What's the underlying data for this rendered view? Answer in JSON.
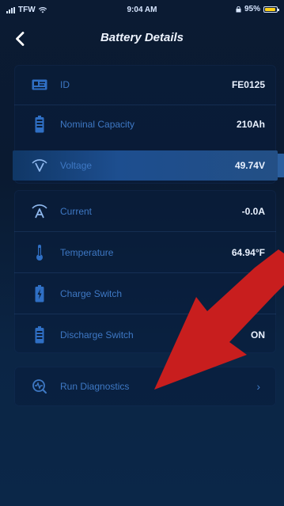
{
  "status_bar": {
    "carrier": "TFW",
    "time": "9:04 AM",
    "battery_percent": "95%"
  },
  "header": {
    "title": "Battery Details"
  },
  "details": [
    {
      "label": "ID",
      "value": "FE0125"
    },
    {
      "label": "Nominal Capacity",
      "value": "210Ah"
    },
    {
      "label": "Voltage",
      "value": "49.74V"
    },
    {
      "label": "Current",
      "value": "-0.0A"
    },
    {
      "label": "Temperature",
      "value": "64.94°F"
    },
    {
      "label": "Charge Switch",
      "value": ""
    },
    {
      "label": "Discharge Switch",
      "value": "ON"
    }
  ],
  "actions": {
    "run_diagnostics": "Run Diagnostics",
    "chevron": "›"
  },
  "colors": {
    "accent": "#3e78c4",
    "overlay_arrow": "#c81e1e"
  }
}
